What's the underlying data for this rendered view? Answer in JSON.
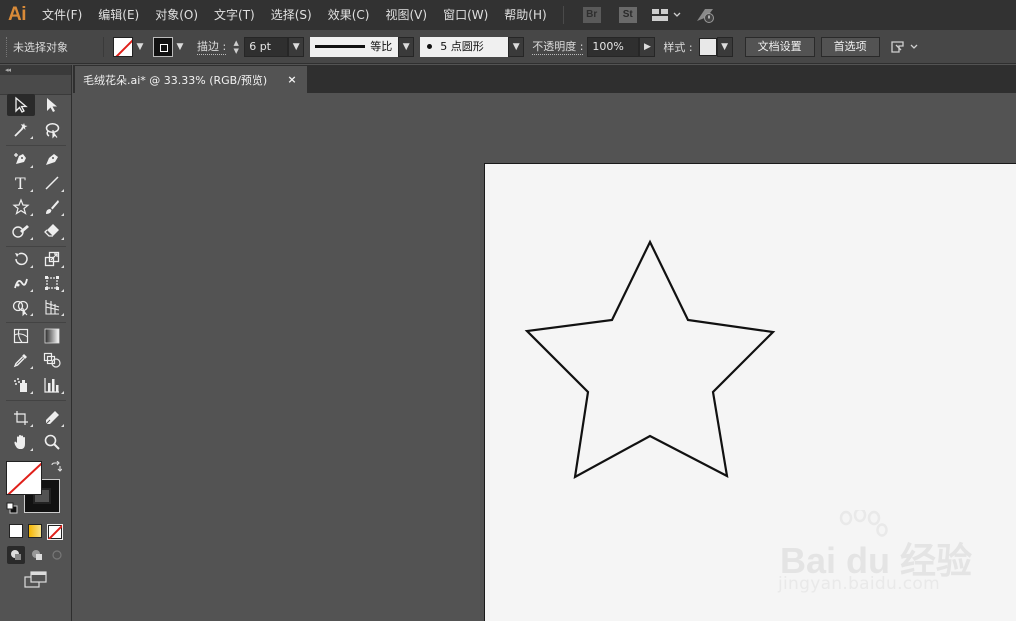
{
  "app": {
    "logo": "Ai",
    "menus": [
      "文件(F)",
      "编辑(E)",
      "对象(O)",
      "文字(T)",
      "选择(S)",
      "效果(C)",
      "视图(V)",
      "窗口(W)",
      "帮助(H)"
    ],
    "bridge_label": "Br",
    "stock_label": "St",
    "menu_icons": [
      "workspace-layout-icon",
      "gpu-rocket-icon"
    ]
  },
  "control_bar": {
    "selection_status": "未选择对象",
    "fill": {
      "state": "none",
      "icon": "fill-none-swatch-icon"
    },
    "stroke": {
      "color": "#111111",
      "icon": "stroke-swatch-icon"
    },
    "stroke_label": "描边 :",
    "stroke_weight": "6 pt",
    "variable_width_profile": "等比",
    "brush_definition": "5 点圆形",
    "opacity_label": "不透明度 :",
    "opacity_value": "100%",
    "style_label": "样式 :",
    "document_setup_button": "文档设置",
    "preferences_button": "首选项"
  },
  "tools_panel": {
    "collapse_label": "◂◂",
    "fill_color": "#ffffff",
    "stroke_color": "#111111"
  },
  "document": {
    "tab_title": "毛绒花朵.ai* @ 33.33% (RGB/预览)",
    "tab_close": "×",
    "zoom_percent": 33.33,
    "color_mode": "RGB/预览",
    "artboard_color": "#f5f5f5",
    "canvas_color": "#535353"
  },
  "artwork": {
    "shape": "star",
    "stroke": "#111111",
    "fill": "none",
    "points": 5
  },
  "watermark": {
    "logo": "Bai du 经验",
    "url": "jingyan.baidu.com"
  }
}
